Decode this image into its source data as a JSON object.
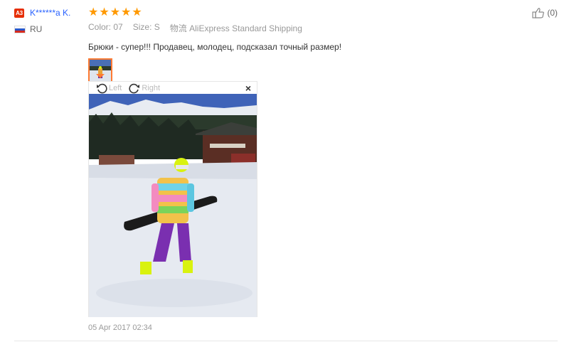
{
  "reviewer": {
    "level_badge": "A3",
    "name": "K******a K.",
    "country_code": "RU"
  },
  "rating": {
    "stars": 5,
    "star_color": "#ff9900"
  },
  "attributes": {
    "color_label": "Color:",
    "color_value": "07",
    "size_label": "Size:",
    "size_value": "S",
    "shipping_label": "物流",
    "shipping_value": "AliExpress Standard Shipping"
  },
  "review_text": "Брюки - супер!!! Продавец, молодец, подсказал точный размер!",
  "viewer": {
    "rotate_left_label": "Left",
    "rotate_right_label": "Right",
    "close_symbol": "×"
  },
  "date": "05 Apr 2017 02:34",
  "helpful": {
    "count_label": "(0)"
  },
  "colors": {
    "accent": "#ff7a32",
    "link": "#2962ff",
    "badge": "#e62e04"
  }
}
